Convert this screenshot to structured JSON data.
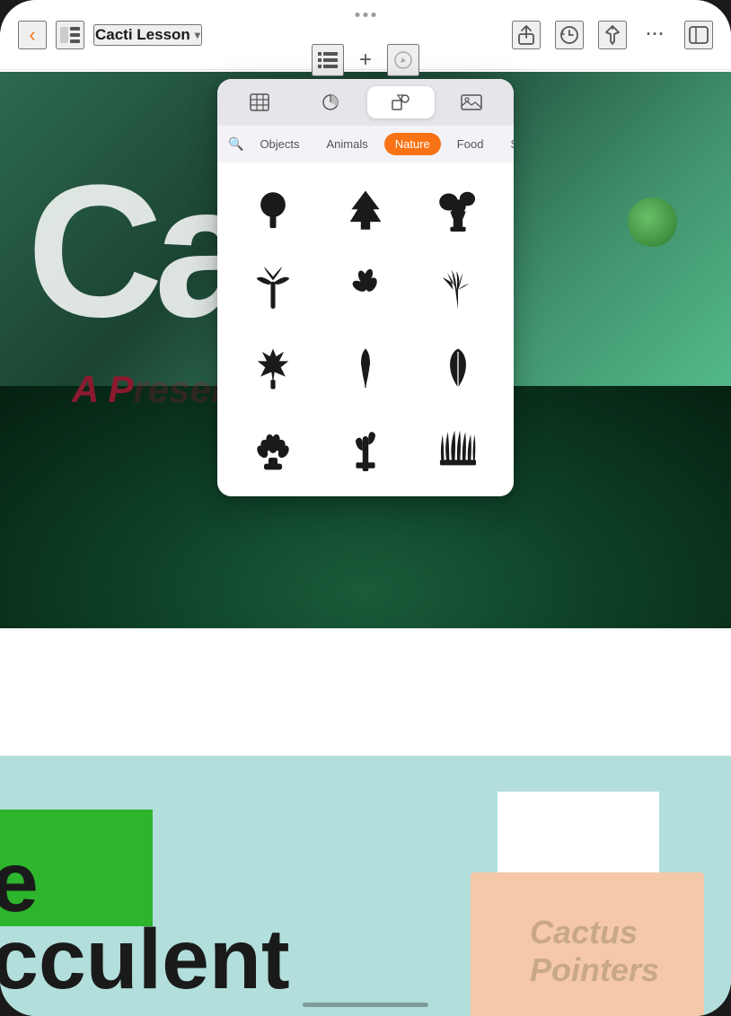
{
  "app": {
    "title": "Cacti Lesson",
    "title_chevron": "▾"
  },
  "nav": {
    "back_label": "‹",
    "sidebar_label": "⊞",
    "title": "Cacti Lesson",
    "dots": [
      "•",
      "•",
      "•"
    ],
    "tools": {
      "list_label": "list",
      "add_label": "+",
      "pen_label": "✏"
    },
    "actions": {
      "share": "⬆",
      "history": "⏱",
      "pin": "📌",
      "more": "···",
      "collab": "⬜"
    }
  },
  "insert_popup": {
    "tabs": [
      {
        "id": "table",
        "label": "⊞",
        "active": false
      },
      {
        "id": "chart",
        "label": "⏱",
        "active": false
      },
      {
        "id": "shapes",
        "label": "⬡",
        "active": true
      },
      {
        "id": "media",
        "label": "🖼",
        "active": false
      }
    ],
    "categories": [
      {
        "id": "objects",
        "label": "Objects",
        "active": false
      },
      {
        "id": "animals",
        "label": "Animals",
        "active": false
      },
      {
        "id": "nature",
        "label": "Nature",
        "active": true
      },
      {
        "id": "food",
        "label": "Food",
        "active": false
      },
      {
        "id": "symbols",
        "label": "Symbols",
        "active": false
      }
    ],
    "search_placeholder": "Search",
    "symbols": [
      {
        "id": "tree",
        "name": "Deciduous Tree"
      },
      {
        "id": "pine",
        "name": "Pine Tree"
      },
      {
        "id": "bonsai",
        "name": "Bonsai Tree"
      },
      {
        "id": "palm",
        "name": "Palm Tree"
      },
      {
        "id": "herb",
        "name": "Herb Plant"
      },
      {
        "id": "fern",
        "name": "Fern"
      },
      {
        "id": "leaf1",
        "name": "Maple Leaf"
      },
      {
        "id": "leaf2",
        "name": "Tulip Leaf"
      },
      {
        "id": "leaf3",
        "name": "Simple Leaf"
      },
      {
        "id": "succulent",
        "name": "Succulent"
      },
      {
        "id": "cactus",
        "name": "Cactus"
      },
      {
        "id": "grass",
        "name": "Grass"
      }
    ]
  },
  "document": {
    "big_title": "Cacti",
    "subtitle": "A P...",
    "bottom_text_line1": "e",
    "bottom_text_line2": "cculent",
    "cactus_watermark": "Cactus",
    "cactus_sub": "Pointers"
  },
  "colors": {
    "accent_orange": "#f97316",
    "nav_bg": "rgba(255,255,255,0.95)",
    "popup_bg": "#f2f2f7",
    "active_category": "#f97316"
  }
}
